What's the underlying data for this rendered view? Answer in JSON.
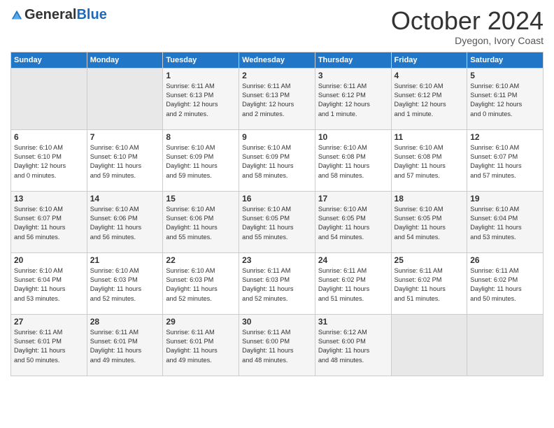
{
  "logo": {
    "general": "General",
    "blue": "Blue"
  },
  "header": {
    "month": "October 2024",
    "location": "Dyegon, Ivory Coast"
  },
  "weekdays": [
    "Sunday",
    "Monday",
    "Tuesday",
    "Wednesday",
    "Thursday",
    "Friday",
    "Saturday"
  ],
  "weeks": [
    [
      {
        "day": "",
        "detail": ""
      },
      {
        "day": "",
        "detail": ""
      },
      {
        "day": "1",
        "detail": "Sunrise: 6:11 AM\nSunset: 6:13 PM\nDaylight: 12 hours\nand 2 minutes."
      },
      {
        "day": "2",
        "detail": "Sunrise: 6:11 AM\nSunset: 6:13 PM\nDaylight: 12 hours\nand 2 minutes."
      },
      {
        "day": "3",
        "detail": "Sunrise: 6:11 AM\nSunset: 6:12 PM\nDaylight: 12 hours\nand 1 minute."
      },
      {
        "day": "4",
        "detail": "Sunrise: 6:10 AM\nSunset: 6:12 PM\nDaylight: 12 hours\nand 1 minute."
      },
      {
        "day": "5",
        "detail": "Sunrise: 6:10 AM\nSunset: 6:11 PM\nDaylight: 12 hours\nand 0 minutes."
      }
    ],
    [
      {
        "day": "6",
        "detail": "Sunrise: 6:10 AM\nSunset: 6:10 PM\nDaylight: 12 hours\nand 0 minutes."
      },
      {
        "day": "7",
        "detail": "Sunrise: 6:10 AM\nSunset: 6:10 PM\nDaylight: 11 hours\nand 59 minutes."
      },
      {
        "day": "8",
        "detail": "Sunrise: 6:10 AM\nSunset: 6:09 PM\nDaylight: 11 hours\nand 59 minutes."
      },
      {
        "day": "9",
        "detail": "Sunrise: 6:10 AM\nSunset: 6:09 PM\nDaylight: 11 hours\nand 58 minutes."
      },
      {
        "day": "10",
        "detail": "Sunrise: 6:10 AM\nSunset: 6:08 PM\nDaylight: 11 hours\nand 58 minutes."
      },
      {
        "day": "11",
        "detail": "Sunrise: 6:10 AM\nSunset: 6:08 PM\nDaylight: 11 hours\nand 57 minutes."
      },
      {
        "day": "12",
        "detail": "Sunrise: 6:10 AM\nSunset: 6:07 PM\nDaylight: 11 hours\nand 57 minutes."
      }
    ],
    [
      {
        "day": "13",
        "detail": "Sunrise: 6:10 AM\nSunset: 6:07 PM\nDaylight: 11 hours\nand 56 minutes."
      },
      {
        "day": "14",
        "detail": "Sunrise: 6:10 AM\nSunset: 6:06 PM\nDaylight: 11 hours\nand 56 minutes."
      },
      {
        "day": "15",
        "detail": "Sunrise: 6:10 AM\nSunset: 6:06 PM\nDaylight: 11 hours\nand 55 minutes."
      },
      {
        "day": "16",
        "detail": "Sunrise: 6:10 AM\nSunset: 6:05 PM\nDaylight: 11 hours\nand 55 minutes."
      },
      {
        "day": "17",
        "detail": "Sunrise: 6:10 AM\nSunset: 6:05 PM\nDaylight: 11 hours\nand 54 minutes."
      },
      {
        "day": "18",
        "detail": "Sunrise: 6:10 AM\nSunset: 6:05 PM\nDaylight: 11 hours\nand 54 minutes."
      },
      {
        "day": "19",
        "detail": "Sunrise: 6:10 AM\nSunset: 6:04 PM\nDaylight: 11 hours\nand 53 minutes."
      }
    ],
    [
      {
        "day": "20",
        "detail": "Sunrise: 6:10 AM\nSunset: 6:04 PM\nDaylight: 11 hours\nand 53 minutes."
      },
      {
        "day": "21",
        "detail": "Sunrise: 6:10 AM\nSunset: 6:03 PM\nDaylight: 11 hours\nand 52 minutes."
      },
      {
        "day": "22",
        "detail": "Sunrise: 6:10 AM\nSunset: 6:03 PM\nDaylight: 11 hours\nand 52 minutes."
      },
      {
        "day": "23",
        "detail": "Sunrise: 6:11 AM\nSunset: 6:03 PM\nDaylight: 11 hours\nand 52 minutes."
      },
      {
        "day": "24",
        "detail": "Sunrise: 6:11 AM\nSunset: 6:02 PM\nDaylight: 11 hours\nand 51 minutes."
      },
      {
        "day": "25",
        "detail": "Sunrise: 6:11 AM\nSunset: 6:02 PM\nDaylight: 11 hours\nand 51 minutes."
      },
      {
        "day": "26",
        "detail": "Sunrise: 6:11 AM\nSunset: 6:02 PM\nDaylight: 11 hours\nand 50 minutes."
      }
    ],
    [
      {
        "day": "27",
        "detail": "Sunrise: 6:11 AM\nSunset: 6:01 PM\nDaylight: 11 hours\nand 50 minutes."
      },
      {
        "day": "28",
        "detail": "Sunrise: 6:11 AM\nSunset: 6:01 PM\nDaylight: 11 hours\nand 49 minutes."
      },
      {
        "day": "29",
        "detail": "Sunrise: 6:11 AM\nSunset: 6:01 PM\nDaylight: 11 hours\nand 49 minutes."
      },
      {
        "day": "30",
        "detail": "Sunrise: 6:11 AM\nSunset: 6:00 PM\nDaylight: 11 hours\nand 48 minutes."
      },
      {
        "day": "31",
        "detail": "Sunrise: 6:12 AM\nSunset: 6:00 PM\nDaylight: 11 hours\nand 48 minutes."
      },
      {
        "day": "",
        "detail": ""
      },
      {
        "day": "",
        "detail": ""
      }
    ]
  ]
}
